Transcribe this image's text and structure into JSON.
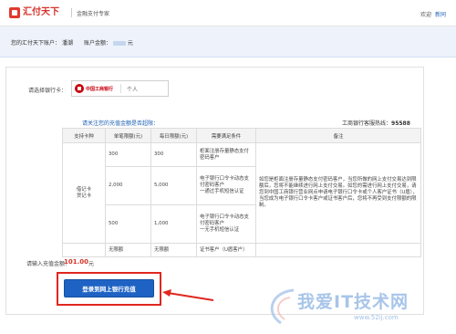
{
  "header": {
    "brand": "汇付天下",
    "tagline": "金融支付专家",
    "welcome": "欢迎",
    "user_link": "新同"
  },
  "account": {
    "account_label": "您的汇付天下账户：",
    "account_value": "潘潮",
    "balance_label": "账户金额：",
    "balance_unit": "元"
  },
  "bank": {
    "select_label": "请选择银行卡：",
    "bank_name": "中国工商银行",
    "card_type": "个人"
  },
  "limits": {
    "note": "请关注您的充值金额是否超限：",
    "service_label": "工商银行客服热线：",
    "service_tel": "95588",
    "headers": [
      "支持卡种",
      "单笔限额(元)",
      "每日限额(元)",
      "需要满足条件",
      "备注"
    ],
    "card_types": "借记卡\n贷记卡",
    "rows": [
      {
        "single": "300",
        "daily": "300",
        "condition": "柜面注册存量静态支付密码客户"
      },
      {
        "single": "2,000",
        "daily": "5,000",
        "condition": "电子银行口令卡动态支付密码客户\n一通过手机短信认证"
      },
      {
        "single": "500",
        "daily": "1,000",
        "condition": "电子银行口令卡动态支付密码客户\n一无手机短信认证"
      },
      {
        "single": "无限额",
        "daily": "无限额",
        "condition": "证书客户（U盾客户）"
      }
    ],
    "remark": "如您是柜面注册存量静态支付密码客户，当您所做的网上支付交易达到限额后，您将不能继续进行网上支付交易。如您的需进行网上支付交易，请您到中国工商银行营业网点申请电子银行口令卡或个人客户证书（U盾），当您成为电子银行口令卡客户或证书客户后，您将不再受到支付限额的限制。"
  },
  "amount": {
    "label": "请输入充值金额：",
    "value": "101.00",
    "unit": "元"
  },
  "submit": {
    "label": "登录到网上银行充值"
  },
  "watermark": {
    "main": "我爱IT技术网",
    "sub": "www.52ij.com"
  },
  "colors": {
    "brand_red": "#d6332a",
    "button_blue": "#1e63c4",
    "highlight_red": "#e0271f",
    "account_bar_bg": "#eef3fb"
  }
}
